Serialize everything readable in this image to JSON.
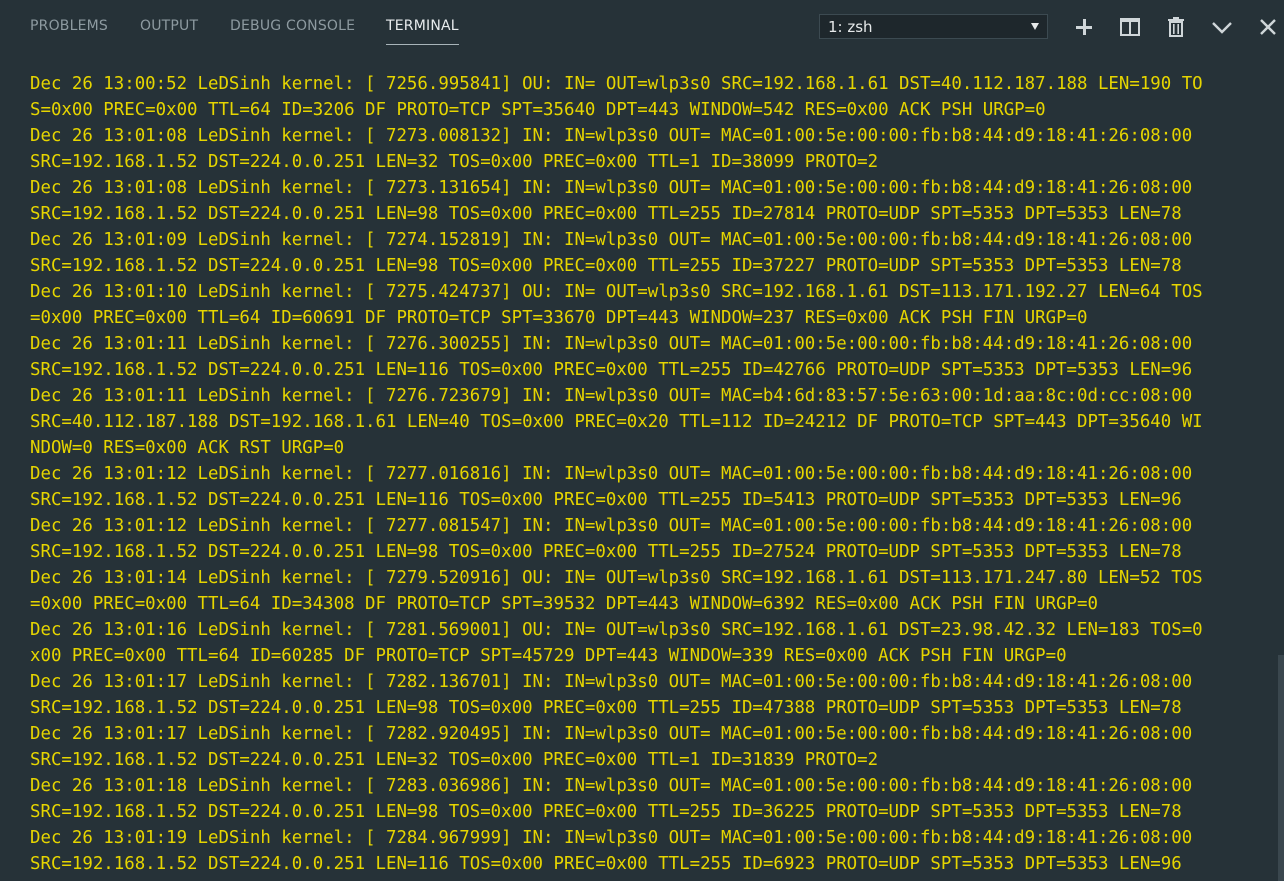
{
  "panel": {
    "tabs": [
      {
        "label": "PROBLEMS"
      },
      {
        "label": "OUTPUT"
      },
      {
        "label": "DEBUG CONSOLE"
      },
      {
        "label": "TERMINAL"
      }
    ],
    "active_tab": "TERMINAL",
    "terminal_select": {
      "value": "1: zsh"
    },
    "actions": [
      {
        "icon": "plus-icon"
      },
      {
        "icon": "split-icon"
      },
      {
        "icon": "trash-icon"
      },
      {
        "icon": "chevron-down-icon"
      },
      {
        "icon": "close-icon"
      }
    ]
  },
  "colors": {
    "background": "#263238",
    "log_text": "#e6d500",
    "tab_inactive": "#8d9aa0",
    "tab_active": "#e8ecee"
  },
  "terminal": {
    "lines": [
      "Dec 26 13:00:52 LeDSinh kernel: [ 7256.995841] OU: IN= OUT=wlp3s0 SRC=192.168.1.61 DST=40.112.187.188 LEN=190 TO",
      "S=0x00 PREC=0x00 TTL=64 ID=3206 DF PROTO=TCP SPT=35640 DPT=443 WINDOW=542 RES=0x00 ACK PSH URGP=0",
      "Dec 26 13:01:08 LeDSinh kernel: [ 7273.008132] IN: IN=wlp3s0 OUT= MAC=01:00:5e:00:00:fb:b8:44:d9:18:41:26:08:00",
      "SRC=192.168.1.52 DST=224.0.0.251 LEN=32 TOS=0x00 PREC=0x00 TTL=1 ID=38099 PROTO=2",
      "Dec 26 13:01:08 LeDSinh kernel: [ 7273.131654] IN: IN=wlp3s0 OUT= MAC=01:00:5e:00:00:fb:b8:44:d9:18:41:26:08:00",
      "SRC=192.168.1.52 DST=224.0.0.251 LEN=98 TOS=0x00 PREC=0x00 TTL=255 ID=27814 PROTO=UDP SPT=5353 DPT=5353 LEN=78",
      "Dec 26 13:01:09 LeDSinh kernel: [ 7274.152819] IN: IN=wlp3s0 OUT= MAC=01:00:5e:00:00:fb:b8:44:d9:18:41:26:08:00",
      "SRC=192.168.1.52 DST=224.0.0.251 LEN=98 TOS=0x00 PREC=0x00 TTL=255 ID=37227 PROTO=UDP SPT=5353 DPT=5353 LEN=78",
      "Dec 26 13:01:10 LeDSinh kernel: [ 7275.424737] OU: IN= OUT=wlp3s0 SRC=192.168.1.61 DST=113.171.192.27 LEN=64 TOS",
      "=0x00 PREC=0x00 TTL=64 ID=60691 DF PROTO=TCP SPT=33670 DPT=443 WINDOW=237 RES=0x00 ACK PSH FIN URGP=0",
      "Dec 26 13:01:11 LeDSinh kernel: [ 7276.300255] IN: IN=wlp3s0 OUT= MAC=01:00:5e:00:00:fb:b8:44:d9:18:41:26:08:00",
      "SRC=192.168.1.52 DST=224.0.0.251 LEN=116 TOS=0x00 PREC=0x00 TTL=255 ID=42766 PROTO=UDP SPT=5353 DPT=5353 LEN=96",
      "Dec 26 13:01:11 LeDSinh kernel: [ 7276.723679] IN: IN=wlp3s0 OUT= MAC=b4:6d:83:57:5e:63:00:1d:aa:8c:0d:cc:08:00",
      "SRC=40.112.187.188 DST=192.168.1.61 LEN=40 TOS=0x00 PREC=0x20 TTL=112 ID=24212 DF PROTO=TCP SPT=443 DPT=35640 WI",
      "NDOW=0 RES=0x00 ACK RST URGP=0",
      "Dec 26 13:01:12 LeDSinh kernel: [ 7277.016816] IN: IN=wlp3s0 OUT= MAC=01:00:5e:00:00:fb:b8:44:d9:18:41:26:08:00",
      "SRC=192.168.1.52 DST=224.0.0.251 LEN=116 TOS=0x00 PREC=0x00 TTL=255 ID=5413 PROTO=UDP SPT=5353 DPT=5353 LEN=96",
      "Dec 26 13:01:12 LeDSinh kernel: [ 7277.081547] IN: IN=wlp3s0 OUT= MAC=01:00:5e:00:00:fb:b8:44:d9:18:41:26:08:00",
      "SRC=192.168.1.52 DST=224.0.0.251 LEN=98 TOS=0x00 PREC=0x00 TTL=255 ID=27524 PROTO=UDP SPT=5353 DPT=5353 LEN=78",
      "Dec 26 13:01:14 LeDSinh kernel: [ 7279.520916] OU: IN= OUT=wlp3s0 SRC=192.168.1.61 DST=113.171.247.80 LEN=52 TOS",
      "=0x00 PREC=0x00 TTL=64 ID=34308 DF PROTO=TCP SPT=39532 DPT=443 WINDOW=6392 RES=0x00 ACK PSH FIN URGP=0",
      "Dec 26 13:01:16 LeDSinh kernel: [ 7281.569001] OU: IN= OUT=wlp3s0 SRC=192.168.1.61 DST=23.98.42.32 LEN=183 TOS=0",
      "x00 PREC=0x00 TTL=64 ID=60285 DF PROTO=TCP SPT=45729 DPT=443 WINDOW=339 RES=0x00 ACK PSH FIN URGP=0",
      "Dec 26 13:01:17 LeDSinh kernel: [ 7282.136701] IN: IN=wlp3s0 OUT= MAC=01:00:5e:00:00:fb:b8:44:d9:18:41:26:08:00",
      "SRC=192.168.1.52 DST=224.0.0.251 LEN=98 TOS=0x00 PREC=0x00 TTL=255 ID=47388 PROTO=UDP SPT=5353 DPT=5353 LEN=78",
      "Dec 26 13:01:17 LeDSinh kernel: [ 7282.920495] IN: IN=wlp3s0 OUT= MAC=01:00:5e:00:00:fb:b8:44:d9:18:41:26:08:00",
      "SRC=192.168.1.52 DST=224.0.0.251 LEN=32 TOS=0x00 PREC=0x00 TTL=1 ID=31839 PROTO=2",
      "Dec 26 13:01:18 LeDSinh kernel: [ 7283.036986] IN: IN=wlp3s0 OUT= MAC=01:00:5e:00:00:fb:b8:44:d9:18:41:26:08:00",
      "SRC=192.168.1.52 DST=224.0.0.251 LEN=98 TOS=0x00 PREC=0x00 TTL=255 ID=36225 PROTO=UDP SPT=5353 DPT=5353 LEN=78",
      "Dec 26 13:01:19 LeDSinh kernel: [ 7284.967999] IN: IN=wlp3s0 OUT= MAC=01:00:5e:00:00:fb:b8:44:d9:18:41:26:08:00",
      "SRC=192.168.1.52 DST=224.0.0.251 LEN=116 TOS=0x00 PREC=0x00 TTL=255 ID=6923 PROTO=UDP SPT=5353 DPT=5353 LEN=96"
    ]
  }
}
